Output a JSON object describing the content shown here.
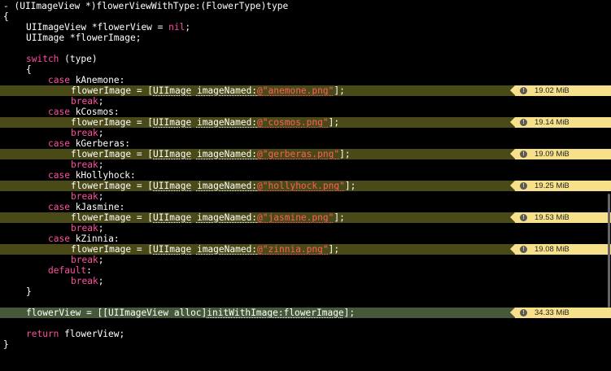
{
  "colors": {
    "background": "#000000",
    "keyword": "#ff4fa0",
    "string": "#ff5f55",
    "highlight_line": "#4a4a18",
    "highlight_final": "#45583a",
    "badge": "#f7e08a"
  },
  "icons": {
    "badge": "warning-circle-icon"
  },
  "code": {
    "signature": "- (UIImageView *)flowerViewWithType:(FlowerType)type",
    "open_brace": "{",
    "decl_view": "UIImageView *flowerView = ",
    "nil": "nil",
    "semicolon": ";",
    "decl_image": "UIImage *flowerImage;",
    "switch_kw": "switch",
    "switch_rest": " (type)",
    "switch_open": "{",
    "case_kw": "case",
    "assign_prefix": "flowerImage = [",
    "image_class": "UIImage",
    "space": " ",
    "image_method": "imageNamed:",
    "assign_suffix": "];",
    "break_kw": "break",
    "default_kw": "default",
    "colon": ":",
    "switch_close": "}",
    "final_prefix": "flowerView = [[UIImageView alloc]",
    "final_method": "initWithImage:flowerImage",
    "final_suffix": "];",
    "return_kw": "return",
    "return_rest": " flowerView;",
    "close_brace": "}"
  },
  "cases": [
    {
      "name": " kAnemone:",
      "file": "@\"anemone.png\"",
      "memory": "19.02 MiB"
    },
    {
      "name": " kCosmos:",
      "file": "@\"cosmos.png\"",
      "memory": "19.14 MiB"
    },
    {
      "name": " kGerberas:",
      "file": "@\"gerberas.png\"",
      "memory": "19.09 MiB"
    },
    {
      "name": " kHollyhock:",
      "file": "@\"hollyhock.png\"",
      "memory": "19.25 MiB"
    },
    {
      "name": " kJasmine:",
      "file": "@\"jasmine.png\"",
      "memory": "19.53 MiB"
    },
    {
      "name": " kZinnia:",
      "file": "@\"zinnia.png\"",
      "memory": "19.08 MiB"
    }
  ],
  "final_memory": "34.33 MiB"
}
